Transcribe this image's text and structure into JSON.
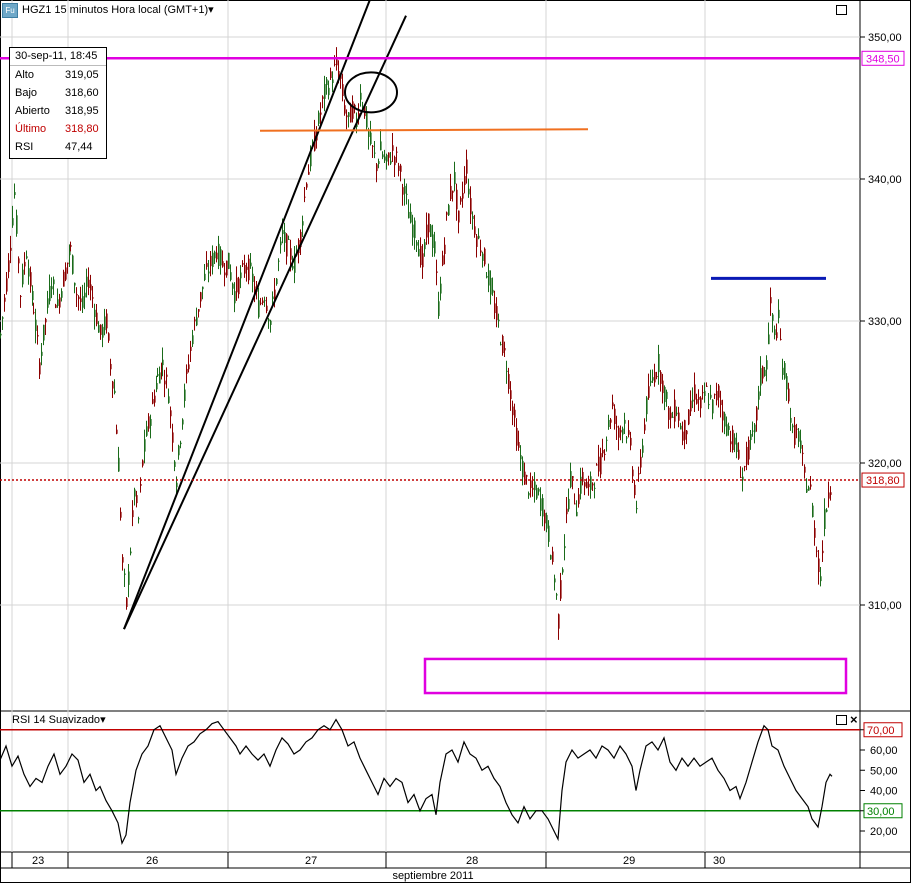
{
  "header": {
    "title": "HGZ1 15 minutos Hora local (GMT+1)",
    "menu_arrow": "▾",
    "icon_label": "Fu"
  },
  "info_box": {
    "datetime": "30-sep-11, 18:45",
    "rows": [
      {
        "label": "Alto",
        "value": "319,05"
      },
      {
        "label": "Bajo",
        "value": "318,60"
      },
      {
        "label": "Abierto",
        "value": "318,95"
      },
      {
        "label": "Último",
        "value": "318,80"
      },
      {
        "label": "RSI",
        "value": "47,44"
      }
    ],
    "last_color": "#c00000"
  },
  "rsi_panel": {
    "title": "RSI 14 Suavizado",
    "menu_arrow": "▾",
    "close_icon": "×"
  },
  "chart_data": [
    {
      "type": "line",
      "title": "HGZ1 15 minutos Hora local (GMT+1)",
      "series_kind": "candlestick",
      "xlabel": "septiembre 2011",
      "x_ticks": [
        "23",
        "26",
        "27",
        "28",
        "29",
        "30"
      ],
      "y_ticks": [
        "310,00",
        "320,00",
        "330,00",
        "340,00",
        "350,00"
      ],
      "ylim": [
        302,
        353
      ],
      "grid": true,
      "price_markers": [
        {
          "label": "348,50",
          "value": 348.5,
          "color": "#e000e0"
        },
        {
          "label": "318,80",
          "value": 318.8,
          "color": "#c00000"
        }
      ],
      "close_path": [
        [
          0,
          329
        ],
        [
          8,
          334
        ],
        [
          14,
          339
        ],
        [
          20,
          332
        ],
        [
          26,
          335
        ],
        [
          33,
          331
        ],
        [
          39,
          327
        ],
        [
          45,
          330
        ],
        [
          51,
          333
        ],
        [
          57,
          331
        ],
        [
          63,
          333
        ],
        [
          70,
          335
        ],
        [
          76,
          332
        ],
        [
          82,
          331
        ],
        [
          88,
          333
        ],
        [
          94,
          331
        ],
        [
          100,
          329
        ],
        [
          106,
          330
        ],
        [
          110,
          327
        ],
        [
          114,
          325
        ],
        [
          118,
          320
        ],
        [
          122,
          313
        ],
        [
          126,
          310
        ],
        [
          130,
          314
        ],
        [
          134,
          318
        ],
        [
          138,
          316
        ],
        [
          142,
          320
        ],
        [
          146,
          322
        ],
        [
          152,
          324
        ],
        [
          157,
          326
        ],
        [
          162,
          327
        ],
        [
          168,
          325
        ],
        [
          172,
          322
        ],
        [
          176,
          319
        ],
        [
          180,
          322
        ],
        [
          186,
          326
        ],
        [
          192,
          329
        ],
        [
          198,
          331
        ],
        [
          204,
          333
        ],
        [
          210,
          334
        ],
        [
          216,
          335
        ],
        [
          222,
          334
        ],
        [
          228,
          334
        ],
        [
          234,
          332
        ],
        [
          240,
          333
        ],
        [
          246,
          334
        ],
        [
          252,
          333
        ],
        [
          258,
          331
        ],
        [
          264,
          332
        ],
        [
          270,
          330
        ],
        [
          276,
          333
        ],
        [
          282,
          336
        ],
        [
          288,
          335
        ],
        [
          294,
          334
        ],
        [
          300,
          336
        ],
        [
          306,
          340
        ],
        [
          312,
          342
        ],
        [
          318,
          344
        ],
        [
          324,
          346
        ],
        [
          330,
          347
        ],
        [
          336,
          348
        ],
        [
          340,
          347
        ],
        [
          344,
          345
        ],
        [
          348,
          344
        ],
        [
          352,
          345
        ],
        [
          356,
          344
        ],
        [
          360,
          346
        ],
        [
          364,
          345
        ],
        [
          368,
          343
        ],
        [
          372,
          342
        ],
        [
          376,
          341
        ],
        [
          380,
          342
        ],
        [
          386,
          341
        ],
        [
          392,
          342
        ],
        [
          398,
          341
        ],
        [
          404,
          339
        ],
        [
          410,
          337
        ],
        [
          416,
          336
        ],
        [
          422,
          334
        ],
        [
          428,
          337
        ],
        [
          434,
          335
        ],
        [
          438,
          331
        ],
        [
          442,
          334
        ],
        [
          446,
          337
        ],
        [
          450,
          339
        ],
        [
          454,
          340
        ],
        [
          458,
          337
        ],
        [
          462,
          339
        ],
        [
          466,
          341
        ],
        [
          470,
          338
        ],
        [
          476,
          336
        ],
        [
          482,
          335
        ],
        [
          488,
          333
        ],
        [
          494,
          331
        ],
        [
          500,
          329
        ],
        [
          506,
          327
        ],
        [
          512,
          324
        ],
        [
          518,
          321
        ],
        [
          524,
          319
        ],
        [
          530,
          318
        ],
        [
          536,
          318
        ],
        [
          542,
          317
        ],
        [
          548,
          315
        ],
        [
          554,
          312
        ],
        [
          558,
          309
        ],
        [
          562,
          313
        ],
        [
          566,
          316
        ],
        [
          570,
          319
        ],
        [
          576,
          317
        ],
        [
          582,
          319
        ],
        [
          588,
          318
        ],
        [
          594,
          319
        ],
        [
          600,
          320
        ],
        [
          606,
          322
        ],
        [
          612,
          324
        ],
        [
          618,
          322
        ],
        [
          624,
          323
        ],
        [
          630,
          321
        ],
        [
          636,
          317
        ],
        [
          640,
          320
        ],
        [
          646,
          324
        ],
        [
          652,
          326
        ],
        [
          658,
          327
        ],
        [
          664,
          325
        ],
        [
          670,
          323
        ],
        [
          676,
          324
        ],
        [
          682,
          322
        ],
        [
          688,
          323
        ],
        [
          694,
          325
        ],
        [
          700,
          324
        ],
        [
          706,
          325
        ],
        [
          712,
          324
        ],
        [
          718,
          325
        ],
        [
          724,
          323
        ],
        [
          730,
          322
        ],
        [
          736,
          321
        ],
        [
          742,
          319
        ],
        [
          748,
          321
        ],
        [
          754,
          322
        ],
        [
          760,
          326
        ],
        [
          766,
          327
        ],
        [
          770,
          331
        ],
        [
          774,
          329
        ],
        [
          778,
          330
        ],
        [
          782,
          327
        ],
        [
          788,
          325
        ],
        [
          792,
          322
        ],
        [
          798,
          322
        ],
        [
          804,
          319
        ],
        [
          810,
          318
        ],
        [
          816,
          314
        ],
        [
          820,
          312
        ],
        [
          824,
          316
        ],
        [
          828,
          318
        ],
        [
          832,
          319
        ]
      ],
      "annotation_lines": [
        {
          "name": "trendline-1",
          "from": [
            124,
            308.3
          ],
          "to": [
            372,
            353
          ]
        },
        {
          "name": "trendline-2",
          "from": [
            124,
            308.3
          ],
          "to": [
            406,
            351.5
          ]
        },
        {
          "name": "resistance-orange",
          "from": [
            260,
            343.4
          ],
          "to": [
            588,
            343.5
          ]
        },
        {
          "name": "level-blue",
          "from": [
            711,
            333.0
          ],
          "to": [
            826,
            333.0
          ]
        },
        {
          "name": "horizontal-magenta",
          "from": [
            0,
            348.5
          ],
          "to": [
            860,
            348.5
          ]
        }
      ]
    },
    {
      "type": "line",
      "title": "RSI 14 Suavizado",
      "y_ticks": [
        "20,00",
        "30,00",
        "40,00",
        "50,00",
        "60,00",
        "70,00"
      ],
      "ylim": [
        12,
        80
      ],
      "levels": [
        {
          "label": "70,00",
          "value": 70,
          "color": "#c00000"
        },
        {
          "label": "30,00",
          "value": 30,
          "color": "#008000"
        }
      ],
      "rsi_path": [
        [
          0,
          55
        ],
        [
          6,
          62
        ],
        [
          12,
          52
        ],
        [
          18,
          57
        ],
        [
          24,
          48
        ],
        [
          30,
          42
        ],
        [
          36,
          46
        ],
        [
          42,
          44
        ],
        [
          48,
          52
        ],
        [
          54,
          58
        ],
        [
          60,
          48
        ],
        [
          66,
          52
        ],
        [
          72,
          58
        ],
        [
          78,
          55
        ],
        [
          84,
          44
        ],
        [
          90,
          48
        ],
        [
          96,
          40
        ],
        [
          100,
          42
        ],
        [
          106,
          35
        ],
        [
          112,
          30
        ],
        [
          118,
          24
        ],
        [
          122,
          14
        ],
        [
          126,
          18
        ],
        [
          130,
          34
        ],
        [
          136,
          50
        ],
        [
          142,
          58
        ],
        [
          148,
          62
        ],
        [
          154,
          70
        ],
        [
          160,
          72
        ],
        [
          166,
          66
        ],
        [
          172,
          60
        ],
        [
          176,
          48
        ],
        [
          182,
          56
        ],
        [
          188,
          62
        ],
        [
          194,
          64
        ],
        [
          200,
          68
        ],
        [
          206,
          70
        ],
        [
          212,
          73
        ],
        [
          218,
          74
        ],
        [
          224,
          70
        ],
        [
          230,
          66
        ],
        [
          236,
          62
        ],
        [
          240,
          58
        ],
        [
          246,
          62
        ],
        [
          252,
          58
        ],
        [
          258,
          55
        ],
        [
          264,
          58
        ],
        [
          270,
          52
        ],
        [
          276,
          60
        ],
        [
          282,
          66
        ],
        [
          288,
          63
        ],
        [
          294,
          58
        ],
        [
          300,
          60
        ],
        [
          306,
          64
        ],
        [
          312,
          66
        ],
        [
          318,
          70
        ],
        [
          324,
          72
        ],
        [
          330,
          70
        ],
        [
          336,
          75
        ],
        [
          342,
          70
        ],
        [
          348,
          62
        ],
        [
          354,
          64
        ],
        [
          360,
          56
        ],
        [
          366,
          50
        ],
        [
          372,
          44
        ],
        [
          378,
          38
        ],
        [
          384,
          46
        ],
        [
          390,
          42
        ],
        [
          396,
          46
        ],
        [
          402,
          44
        ],
        [
          408,
          34
        ],
        [
          414,
          38
        ],
        [
          420,
          30
        ],
        [
          426,
          36
        ],
        [
          432,
          38
        ],
        [
          436,
          28
        ],
        [
          440,
          44
        ],
        [
          446,
          58
        ],
        [
          452,
          60
        ],
        [
          458,
          54
        ],
        [
          464,
          64
        ],
        [
          470,
          58
        ],
        [
          476,
          56
        ],
        [
          482,
          50
        ],
        [
          488,
          52
        ],
        [
          494,
          46
        ],
        [
          500,
          42
        ],
        [
          506,
          34
        ],
        [
          512,
          28
        ],
        [
          518,
          24
        ],
        [
          524,
          32
        ],
        [
          530,
          26
        ],
        [
          536,
          30
        ],
        [
          542,
          30
        ],
        [
          548,
          26
        ],
        [
          554,
          20
        ],
        [
          558,
          16
        ],
        [
          562,
          40
        ],
        [
          566,
          54
        ],
        [
          572,
          60
        ],
        [
          578,
          56
        ],
        [
          584,
          58
        ],
        [
          590,
          60
        ],
        [
          596,
          56
        ],
        [
          602,
          62
        ],
        [
          608,
          60
        ],
        [
          614,
          56
        ],
        [
          620,
          62
        ],
        [
          626,
          58
        ],
        [
          632,
          52
        ],
        [
          636,
          40
        ],
        [
          640,
          50
        ],
        [
          646,
          62
        ],
        [
          652,
          64
        ],
        [
          658,
          60
        ],
        [
          664,
          66
        ],
        [
          670,
          54
        ],
        [
          676,
          50
        ],
        [
          682,
          56
        ],
        [
          688,
          52
        ],
        [
          694,
          56
        ],
        [
          700,
          52
        ],
        [
          706,
          54
        ],
        [
          712,
          56
        ],
        [
          718,
          50
        ],
        [
          724,
          46
        ],
        [
          730,
          40
        ],
        [
          736,
          42
        ],
        [
          740,
          36
        ],
        [
          746,
          44
        ],
        [
          752,
          54
        ],
        [
          758,
          64
        ],
        [
          764,
          72
        ],
        [
          768,
          70
        ],
        [
          772,
          62
        ],
        [
          778,
          60
        ],
        [
          784,
          52
        ],
        [
          790,
          46
        ],
        [
          796,
          40
        ],
        [
          802,
          36
        ],
        [
          808,
          32
        ],
        [
          812,
          26
        ],
        [
          818,
          22
        ],
        [
          822,
          32
        ],
        [
          826,
          44
        ],
        [
          830,
          48
        ],
        [
          832,
          47
        ]
      ]
    }
  ],
  "x_axis": {
    "label": "septiembre 2011",
    "ticks": [
      {
        "label": "23",
        "day": 23
      },
      {
        "label": "26",
        "day": 26
      },
      {
        "label": "27",
        "day": 27
      },
      {
        "label": "28",
        "day": 28
      },
      {
        "label": "29",
        "day": 29
      },
      {
        "label": "30",
        "day": 30
      }
    ]
  },
  "colors": {
    "grid": "#d4d4d4",
    "candle_up": "#1a6b1a",
    "candle_down": "#8b0000",
    "trend": "#000000",
    "orange": "#f07020",
    "blue": "#0a1ab5",
    "magenta": "#e000e0"
  }
}
